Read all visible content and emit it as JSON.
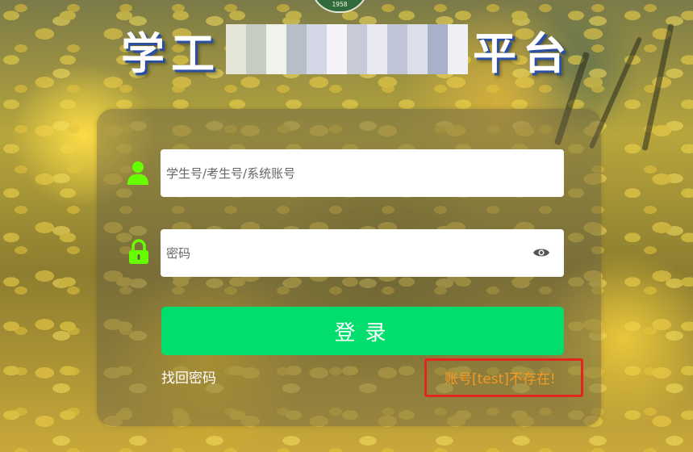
{
  "header": {
    "emblem_year": "1958",
    "title_left": "学工",
    "title_right": "平台"
  },
  "login_form": {
    "username_placeholder": "学生号/考生号/系统账号",
    "username_value": "",
    "password_placeholder": "密码",
    "password_value": "",
    "login_label": "登录",
    "forgot_password_label": "找回密码",
    "error_message": "账号[test]不存在!"
  },
  "icons": {
    "username": "user-icon",
    "password": "lock-icon",
    "toggle_password": "eye-icon"
  },
  "colors": {
    "accent_green": "#02de6e",
    "icon_green": "#66ff00",
    "error_text": "#f59a23",
    "error_outline": "#e2261c"
  }
}
